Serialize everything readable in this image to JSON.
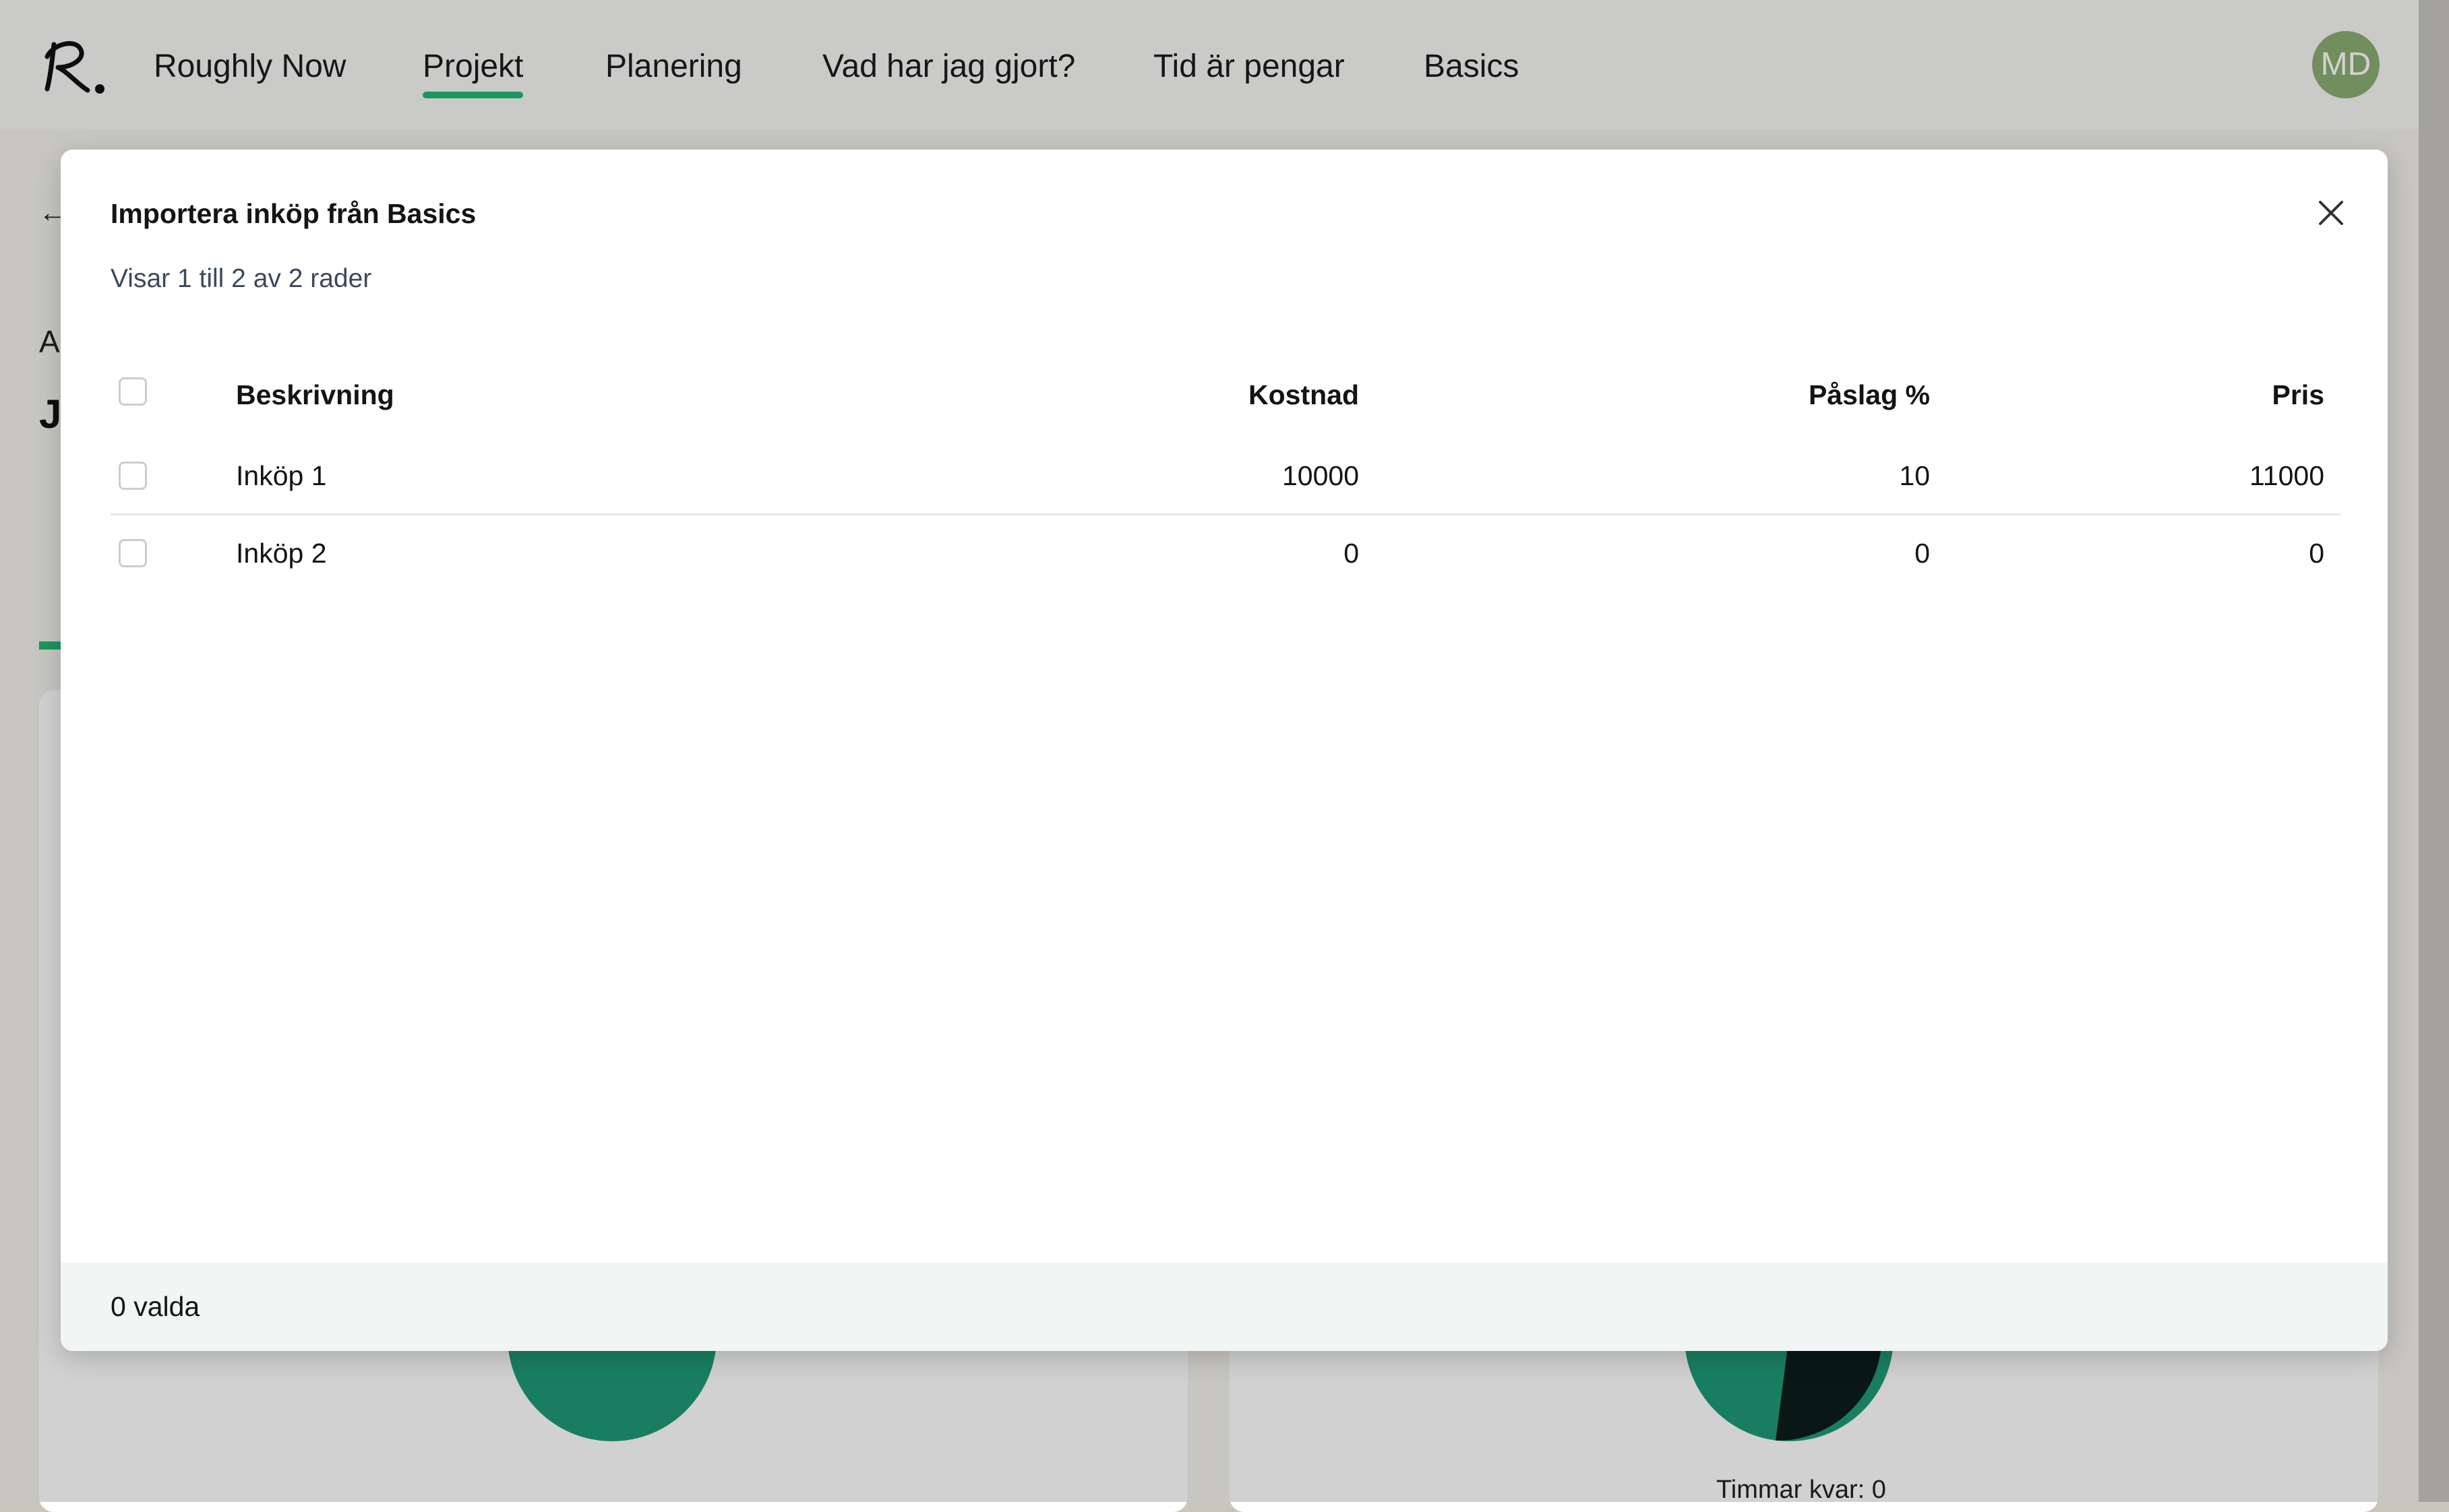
{
  "nav": {
    "items": [
      {
        "label": "Roughly Now"
      },
      {
        "label": "Projekt",
        "active": true
      },
      {
        "label": "Planering"
      },
      {
        "label": "Vad har jag gjort?"
      },
      {
        "label": "Tid är pengar"
      },
      {
        "label": "Basics"
      }
    ],
    "avatar_initials": "MD",
    "accent_color": "#23b872",
    "avatar_color": "#8aae73"
  },
  "background_page": {
    "back_icon": "arrow-left-icon",
    "partial_heading_a": "A",
    "partial_heading_j": "J",
    "card_caption": "Timmar kvar: 0",
    "pie_colors": [
      "#1f9a77",
      "#0c1d1b"
    ]
  },
  "modal": {
    "title": "Importera inköp från Basics",
    "subtitle": "Visar 1 till 2 av 2 rader",
    "close_icon": "close-icon",
    "columns": {
      "description": "Beskrivning",
      "cost": "Kostnad",
      "markup": "Påslag %",
      "price": "Pris"
    },
    "rows": [
      {
        "description": "Inköp 1",
        "cost": "10000",
        "markup": "10",
        "price": "11000",
        "checked": false
      },
      {
        "description": "Inköp 2",
        "cost": "0",
        "markup": "0",
        "price": "0",
        "checked": false
      }
    ],
    "footer_text": "0 valda"
  }
}
